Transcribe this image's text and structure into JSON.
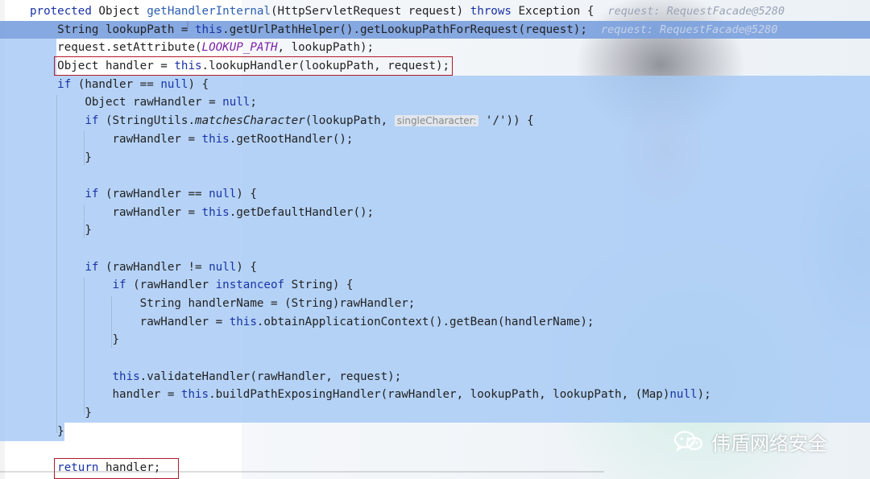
{
  "code_lines": [
    {
      "segments": [
        {
          "t": "protected",
          "c": "kw"
        },
        {
          "t": " Object "
        },
        {
          "t": "getHandlerInternal",
          "c": "fn"
        },
        {
          "t": "(HttpServletRequest request) "
        },
        {
          "t": "throws",
          "c": "kw"
        },
        {
          "t": " Exception {  "
        },
        {
          "t": "request: RequestFacade@5280",
          "c": "hint"
        }
      ]
    },
    {
      "segments": [
        {
          "t": "    String lookupPath = "
        },
        {
          "t": "this",
          "c": "kw"
        },
        {
          "t": ".getUrlPathHelper().getLookupPathForRequest(request);  "
        },
        {
          "t": "request: RequestFacade@5280",
          "c": "hint"
        }
      ]
    },
    {
      "segments": [
        {
          "t": "    request.setAttribute("
        },
        {
          "t": "LOOKUP_PATH",
          "c": "st"
        },
        {
          "t": ", lookupPath);"
        }
      ]
    },
    {
      "segments": [
        {
          "t": "    Object handler = "
        },
        {
          "t": "this",
          "c": "kw"
        },
        {
          "t": ".lookupHandler(lookupPath, request);"
        }
      ]
    },
    {
      "segments": [
        {
          "t": "    "
        },
        {
          "t": "if",
          "c": "kw"
        },
        {
          "t": " (handler == "
        },
        {
          "t": "null",
          "c": "kw"
        },
        {
          "t": ") {"
        }
      ]
    },
    {
      "segments": [
        {
          "t": "        Object rawHandler = "
        },
        {
          "t": "null",
          "c": "kw"
        },
        {
          "t": ";"
        }
      ]
    },
    {
      "segments": [
        {
          "t": "        "
        },
        {
          "t": "if",
          "c": "kw"
        },
        {
          "t": " (StringUtils."
        },
        {
          "t": "matchesCharacter",
          "c": "sm"
        },
        {
          "t": "(lookupPath, "
        },
        {
          "t": "singleCharacter:",
          "c": "hintbox"
        },
        {
          "t": " '/')) {"
        }
      ]
    },
    {
      "segments": [
        {
          "t": "            rawHandler = "
        },
        {
          "t": "this",
          "c": "kw"
        },
        {
          "t": ".getRootHandler();"
        }
      ]
    },
    {
      "segments": [
        {
          "t": "        }"
        }
      ]
    },
    {
      "segments": [
        {
          "t": ""
        }
      ]
    },
    {
      "segments": [
        {
          "t": "        "
        },
        {
          "t": "if",
          "c": "kw"
        },
        {
          "t": " (rawHandler == "
        },
        {
          "t": "null",
          "c": "kw"
        },
        {
          "t": ") {"
        }
      ]
    },
    {
      "segments": [
        {
          "t": "            rawHandler = "
        },
        {
          "t": "this",
          "c": "kw"
        },
        {
          "t": ".getDefaultHandler();"
        }
      ]
    },
    {
      "segments": [
        {
          "t": "        }"
        }
      ]
    },
    {
      "segments": [
        {
          "t": ""
        }
      ]
    },
    {
      "segments": [
        {
          "t": "        "
        },
        {
          "t": "if",
          "c": "kw"
        },
        {
          "t": " (rawHandler != "
        },
        {
          "t": "null",
          "c": "kw"
        },
        {
          "t": ") {"
        }
      ]
    },
    {
      "segments": [
        {
          "t": "            "
        },
        {
          "t": "if",
          "c": "kw"
        },
        {
          "t": " (rawHandler "
        },
        {
          "t": "instanceof",
          "c": "kw"
        },
        {
          "t": " String) {"
        }
      ]
    },
    {
      "segments": [
        {
          "t": "                String handlerName = (String)rawHandler;"
        }
      ]
    },
    {
      "segments": [
        {
          "t": "                rawHandler = "
        },
        {
          "t": "this",
          "c": "kw"
        },
        {
          "t": ".obtainApplicationContext().getBean(handlerName);"
        }
      ]
    },
    {
      "segments": [
        {
          "t": "            }"
        }
      ]
    },
    {
      "segments": [
        {
          "t": ""
        }
      ]
    },
    {
      "segments": [
        {
          "t": "            "
        },
        {
          "t": "this",
          "c": "kw"
        },
        {
          "t": ".validateHandler(rawHandler, request);"
        }
      ]
    },
    {
      "segments": [
        {
          "t": "            handler = "
        },
        {
          "t": "this",
          "c": "kw"
        },
        {
          "t": ".buildPathExposingHandler(rawHandler, lookupPath, lookupPath, (Map)"
        },
        {
          "t": "null",
          "c": "kw"
        },
        {
          "t": ");"
        }
      ]
    },
    {
      "segments": [
        {
          "t": "        }"
        }
      ]
    },
    {
      "segments": [
        {
          "t": "    }"
        }
      ]
    },
    {
      "segments": [
        {
          "t": ""
        }
      ]
    },
    {
      "segments": [
        {
          "t": "    "
        },
        {
          "t": "return",
          "c": "kw"
        },
        {
          "t": " handler;"
        }
      ]
    }
  ],
  "watermark": {
    "text": "伟盾网络安全",
    "icon": "wechat-icon"
  },
  "colors": {
    "keyword": "#1a33a6",
    "selection": "#a6c9f5",
    "current_line": "#7aa0de",
    "highlight_box": "#b01a2a"
  }
}
